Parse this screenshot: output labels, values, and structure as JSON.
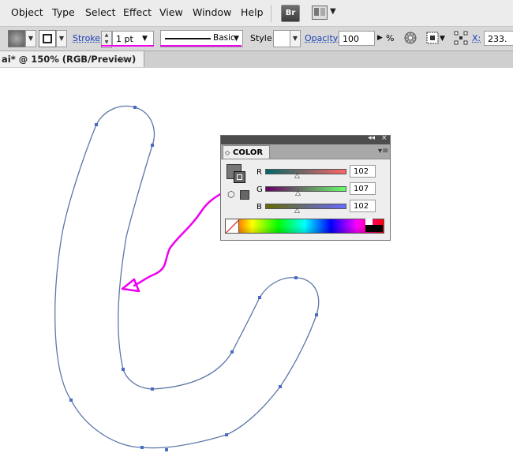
{
  "menu": {
    "items": [
      "Object",
      "Type",
      "Select",
      "Effect",
      "View",
      "Window",
      "Help"
    ],
    "bridge_label": "Br"
  },
  "control_bar": {
    "stroke_label": "Stroke:",
    "stroke_weight": "1 pt",
    "stroke_profile": "Basic",
    "style_label": "Style:",
    "opacity_label": "Opacity:",
    "opacity_value": "100",
    "opacity_unit": "%",
    "x_label": "X:",
    "x_value": "233."
  },
  "document_tab": {
    "title": "ai* @ 150% (RGB/Preview)",
    "close": "×"
  },
  "color_panel": {
    "tab_title": "COLOR",
    "collapse_icon": "◂◂",
    "close_icon": "×",
    "menu_icon": "▾≡",
    "channels": [
      {
        "label": "R",
        "value": "102",
        "gradient_start": "#006666",
        "gradient_end": "#ff6666"
      },
      {
        "label": "G",
        "value": "107",
        "gradient_start": "#660066",
        "gradient_end": "#66ff66"
      },
      {
        "label": "B",
        "value": "102",
        "gradient_start": "#666b00",
        "gradient_end": "#666bff"
      }
    ]
  },
  "colors": {
    "path_stroke": "#5c77a8",
    "anchor": "#4a6ac4",
    "annotation": "#ee00ee",
    "link_blue": "#1a3fb7"
  }
}
